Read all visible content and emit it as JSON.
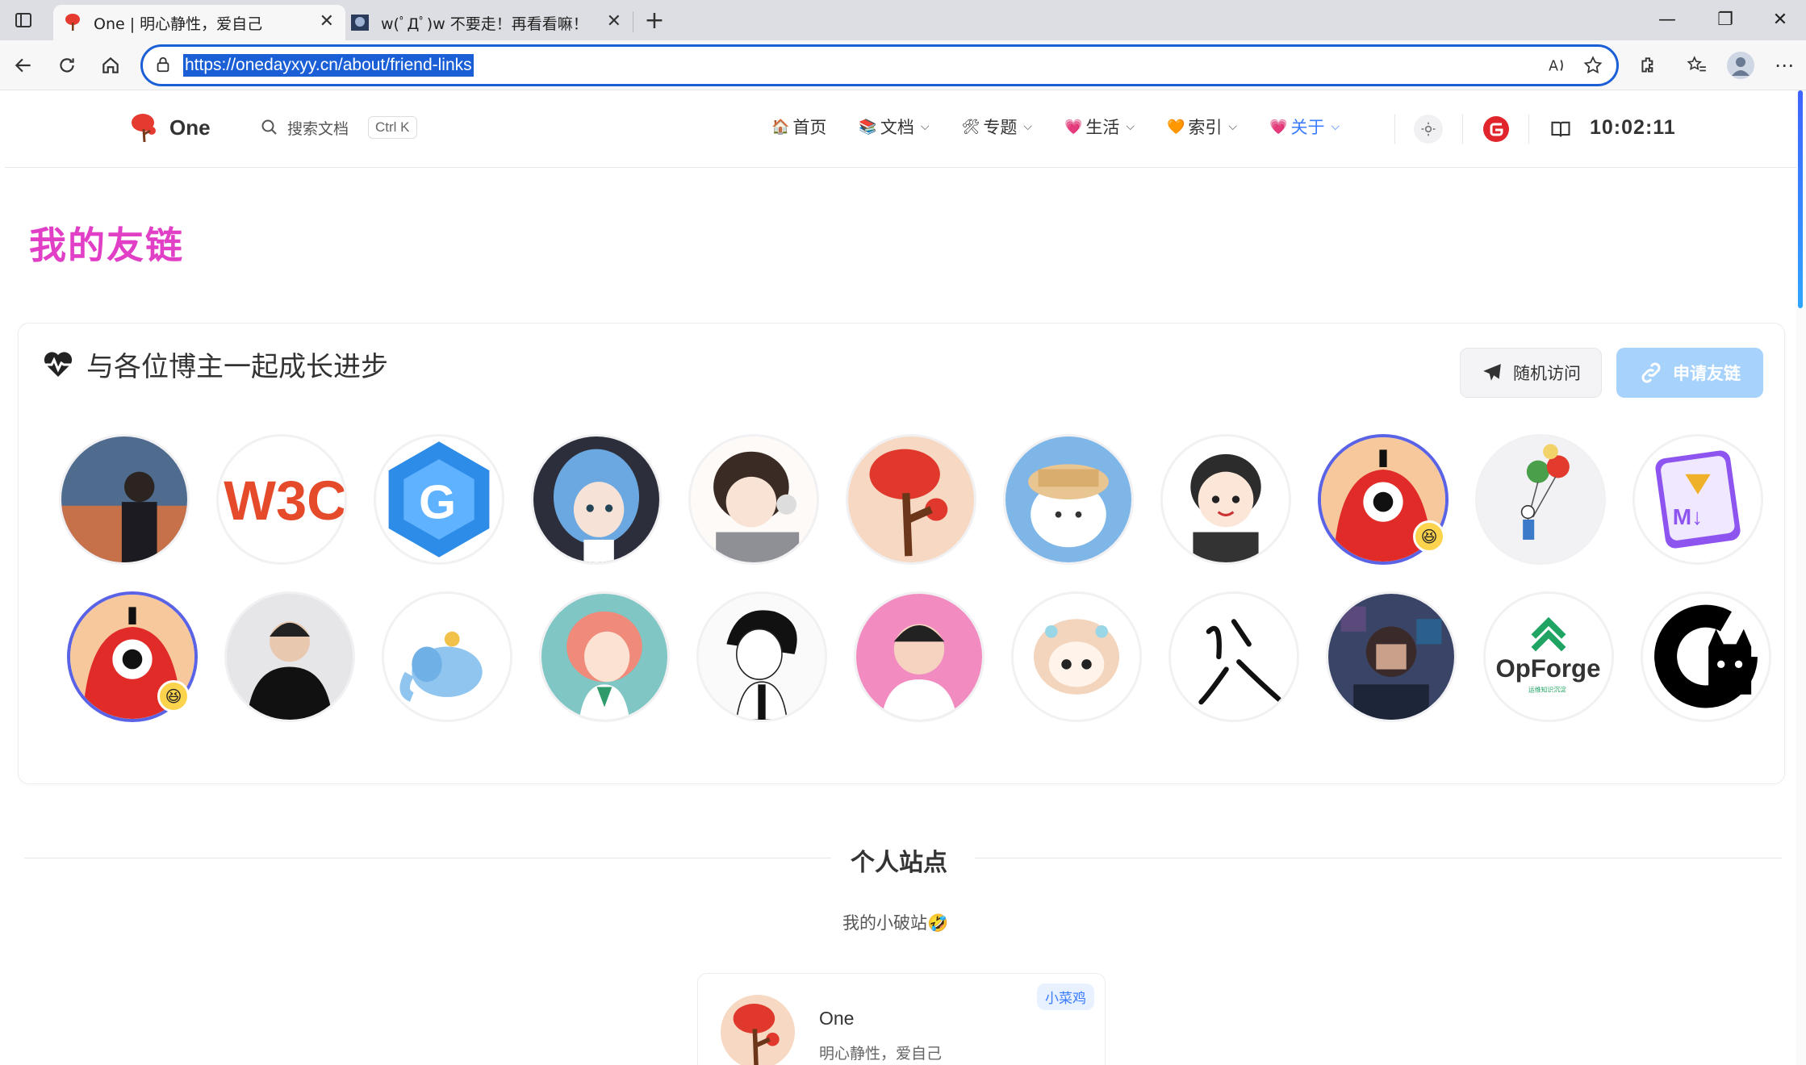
{
  "browser": {
    "tabs": [
      {
        "title": "One | 明心静性，爱自己",
        "active": true
      },
      {
        "title": "w(ﾟДﾟ)w 不要走！再看看嘛！",
        "active": false
      }
    ],
    "address": "https://onedayxyy.cn/about/friend-links"
  },
  "header": {
    "logo_text": "One",
    "search_placeholder": "搜索文档",
    "search_shortcut": "Ctrl K",
    "nav": [
      {
        "label": "首页",
        "emoji": "🏠",
        "dropdown": false
      },
      {
        "label": "文档",
        "emoji": "📚",
        "dropdown": true
      },
      {
        "label": "专题",
        "emoji": "🛠",
        "dropdown": true
      },
      {
        "label": "生活",
        "emoji": "💗",
        "dropdown": true
      },
      {
        "label": "索引",
        "emoji": "🧡",
        "dropdown": true
      },
      {
        "label": "关于",
        "emoji": "💗",
        "dropdown": true,
        "active": true
      }
    ],
    "clock": "10:02:11"
  },
  "page": {
    "title": "我的友链",
    "card_title": "与各位博主一起成长进步",
    "random_button": "随机访问",
    "apply_button": "申请友链",
    "logos": {
      "w3c": "W3C",
      "g": "G",
      "md": "M↓",
      "opforge": "OpForge",
      "opforge_sub": "运维知识沉淀"
    },
    "section_title": "个人站点",
    "section_sub": "我的小破站🤣",
    "site": {
      "name": "One",
      "desc": "明心静性，爱自己",
      "tag": "小菜鸡"
    }
  },
  "colors": {
    "accent": "#3a7bff",
    "title": "#e23fc7",
    "ring": "#5a63e6"
  }
}
